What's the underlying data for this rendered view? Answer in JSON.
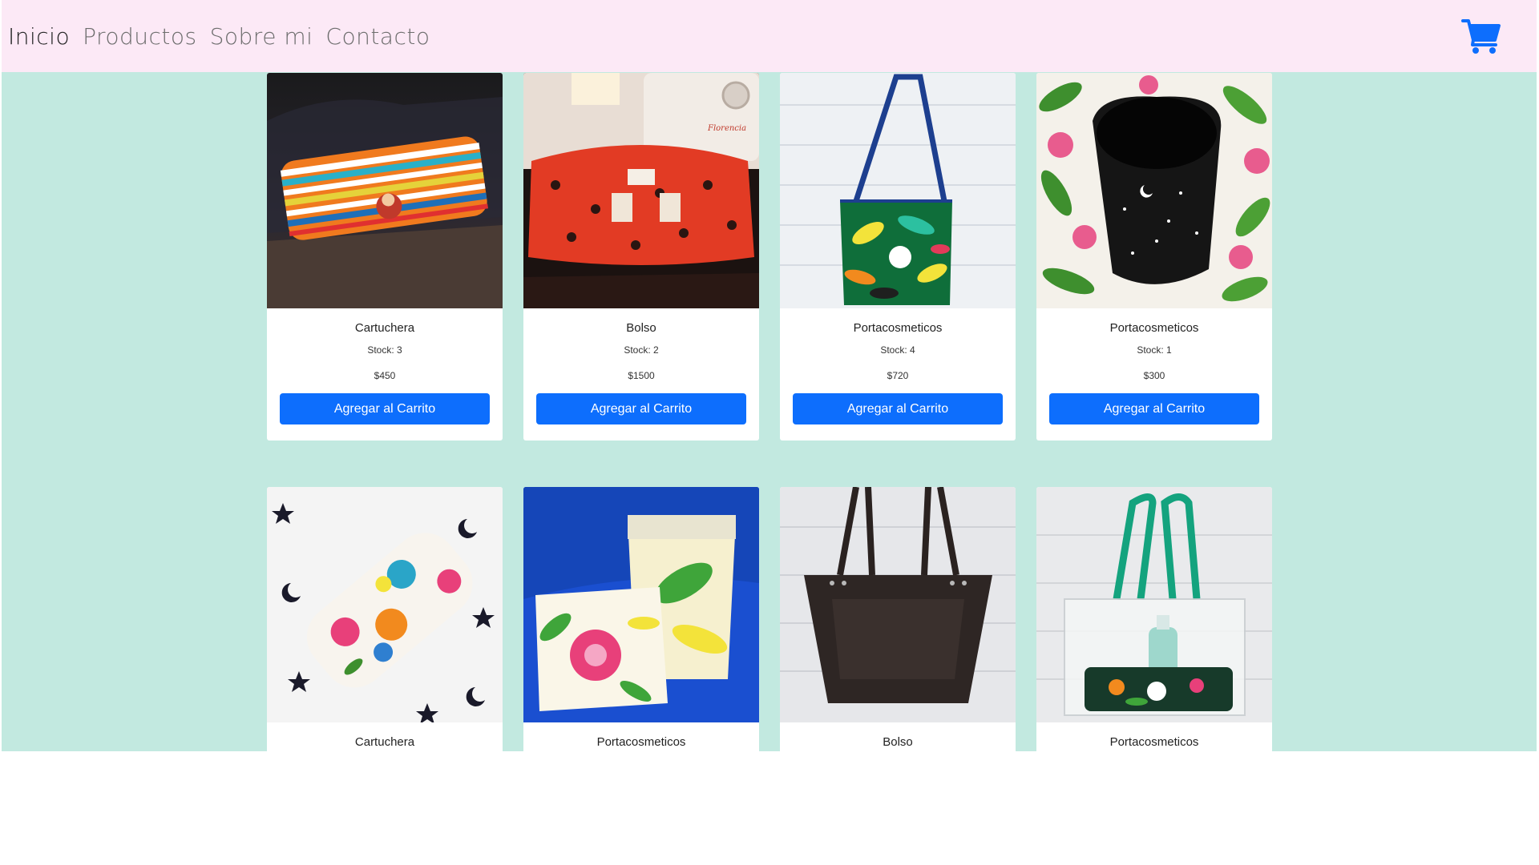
{
  "nav": {
    "links": [
      "Inicio",
      "Productos",
      "Sobre mi",
      "Contacto"
    ],
    "active": "Inicio",
    "cart_icon": "shopping-cart-icon",
    "cart_color": "#0d6efd"
  },
  "colors": {
    "navbar_bg": "#fce9f6",
    "content_bg": "#c2e9e0",
    "button_bg": "#0d6efd"
  },
  "products": [
    {
      "name": "Cartuchera",
      "stock": "Stock: 3",
      "price": "$450",
      "button": "Agregar al Carrito"
    },
    {
      "name": "Bolso",
      "stock": "Stock: 2",
      "price": "$1500",
      "button": "Agregar al Carrito"
    },
    {
      "name": "Portacosmeticos",
      "stock": "Stock: 4",
      "price": "$720",
      "button": "Agregar al Carrito"
    },
    {
      "name": "Portacosmeticos",
      "stock": "Stock: 1",
      "price": "$300",
      "button": "Agregar al Carrito"
    },
    {
      "name": "Cartuchera",
      "stock": "",
      "price": "",
      "button": ""
    },
    {
      "name": "Portacosmeticos",
      "stock": "",
      "price": "",
      "button": ""
    },
    {
      "name": "Bolso",
      "stock": "",
      "price": "",
      "button": ""
    },
    {
      "name": "Portacosmeticos",
      "stock": "",
      "price": "",
      "button": ""
    }
  ]
}
